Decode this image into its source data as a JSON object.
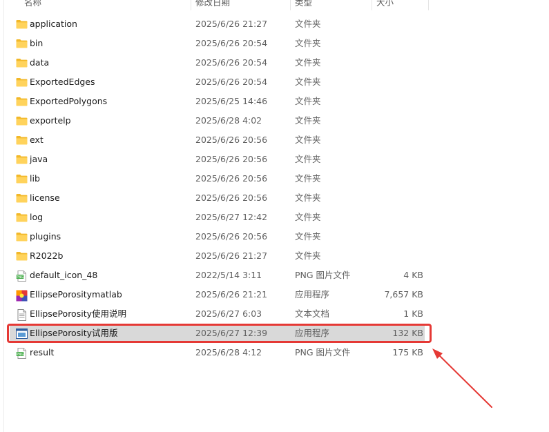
{
  "columns": {
    "name": "名称",
    "date": "修改日期",
    "type": "类型",
    "size": "大小"
  },
  "files": [
    {
      "name": "application",
      "date": "2025/6/26 21:27",
      "type": "文件夹",
      "size": "",
      "icon": "folder-icon"
    },
    {
      "name": "bin",
      "date": "2025/6/26 20:54",
      "type": "文件夹",
      "size": "",
      "icon": "folder-icon"
    },
    {
      "name": "data",
      "date": "2025/6/26 20:54",
      "type": "文件夹",
      "size": "",
      "icon": "folder-icon"
    },
    {
      "name": "ExportedEdges",
      "date": "2025/6/26 20:54",
      "type": "文件夹",
      "size": "",
      "icon": "folder-icon"
    },
    {
      "name": "ExportedPolygons",
      "date": "2025/6/25 14:46",
      "type": "文件夹",
      "size": "",
      "icon": "folder-icon"
    },
    {
      "name": "exportelp",
      "date": "2025/6/28 4:02",
      "type": "文件夹",
      "size": "",
      "icon": "folder-icon"
    },
    {
      "name": "ext",
      "date": "2025/6/26 20:56",
      "type": "文件夹",
      "size": "",
      "icon": "folder-icon"
    },
    {
      "name": "java",
      "date": "2025/6/26 20:56",
      "type": "文件夹",
      "size": "",
      "icon": "folder-icon"
    },
    {
      "name": "lib",
      "date": "2025/6/26 20:56",
      "type": "文件夹",
      "size": "",
      "icon": "folder-icon"
    },
    {
      "name": "license",
      "date": "2025/6/26 20:56",
      "type": "文件夹",
      "size": "",
      "icon": "folder-icon"
    },
    {
      "name": "log",
      "date": "2025/6/27 12:42",
      "type": "文件夹",
      "size": "",
      "icon": "folder-icon"
    },
    {
      "name": "plugins",
      "date": "2025/6/26 20:56",
      "type": "文件夹",
      "size": "",
      "icon": "folder-icon"
    },
    {
      "name": "R2022b",
      "date": "2025/6/26 21:27",
      "type": "文件夹",
      "size": "",
      "icon": "folder-icon"
    },
    {
      "name": "default_icon_48",
      "date": "2022/5/14 3:11",
      "type": "PNG 图片文件",
      "size": "4 KB",
      "icon": "png-file-icon"
    },
    {
      "name": "EllipsePorositymatlab",
      "date": "2025/6/26 21:21",
      "type": "应用程序",
      "size": "7,657 KB",
      "icon": "app-colorful-icon"
    },
    {
      "name": "EllipsePorosity使用说明",
      "date": "2025/6/27 6:03",
      "type": "文本文档",
      "size": "1 KB",
      "icon": "text-document-icon"
    },
    {
      "name": "EllipsePorosity试用版",
      "date": "2025/6/27 12:39",
      "type": "应用程序",
      "size": "132 KB",
      "icon": "app-window-icon",
      "selected": true
    },
    {
      "name": "result",
      "date": "2025/6/28 4:12",
      "type": "PNG 图片文件",
      "size": "175 KB",
      "icon": "png-file-icon"
    }
  ],
  "annotation": {
    "highlight_color": "#e53935",
    "selected_bg": "#d9d9d9",
    "folder_color": "#f4c542"
  }
}
